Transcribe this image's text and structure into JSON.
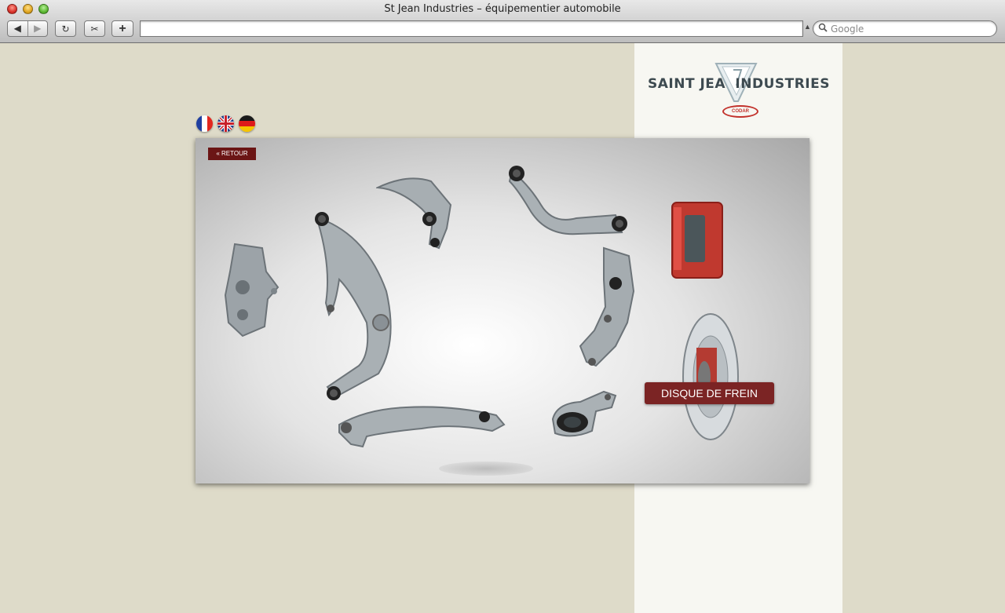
{
  "window": {
    "title": "St Jean Industries – équipementier automobile"
  },
  "toolbar": {
    "back_icon": "◀",
    "forward_icon": "▶",
    "reload_icon": "↻",
    "snip_icon": "✂",
    "add_icon": "+",
    "address_value": "",
    "address_caret": "▲",
    "search_icon": "🔍",
    "search_placeholder": "Google"
  },
  "page": {
    "logo": {
      "left": "SAINT JEAN",
      "right": "INDUSTRIES",
      "badge": "CODAR"
    },
    "languages": [
      "fr",
      "en",
      "de"
    ],
    "retour_label": "« RETOUR",
    "hover_label": "DISQUE DE FREIN"
  },
  "colors": {
    "background": "#dedbc9",
    "panel": "#f7f7f2",
    "accent": "#7b2424"
  }
}
